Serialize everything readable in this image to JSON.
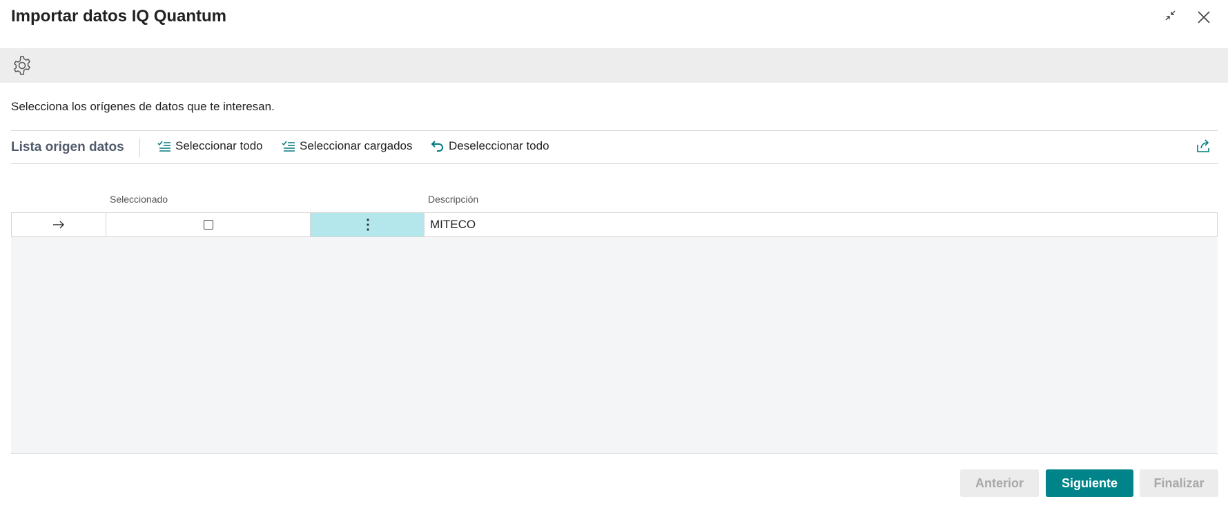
{
  "dialog": {
    "title": "Importar datos IQ Quantum",
    "instruction": "Selecciona los orígenes de datos que te interesan."
  },
  "toolbar": {
    "title": "Lista origen datos",
    "actions": [
      {
        "label": "Seleccionar todo",
        "icon": "check-list-icon"
      },
      {
        "label": "Seleccionar cargados",
        "icon": "check-list-icon"
      },
      {
        "label": "Deseleccionar todo",
        "icon": "undo-icon"
      }
    ],
    "share_icon": "share-icon"
  },
  "table": {
    "columns": [
      "Seleccionado",
      "Descripción"
    ],
    "rows": [
      {
        "selected": false,
        "description": "MITECO"
      }
    ]
  },
  "footer": {
    "previous": "Anterior",
    "next": "Siguiente",
    "finish": "Finalizar"
  },
  "colors": {
    "accent": "#008489",
    "link": "#00797f",
    "row_highlight": "#b3e7ec"
  }
}
